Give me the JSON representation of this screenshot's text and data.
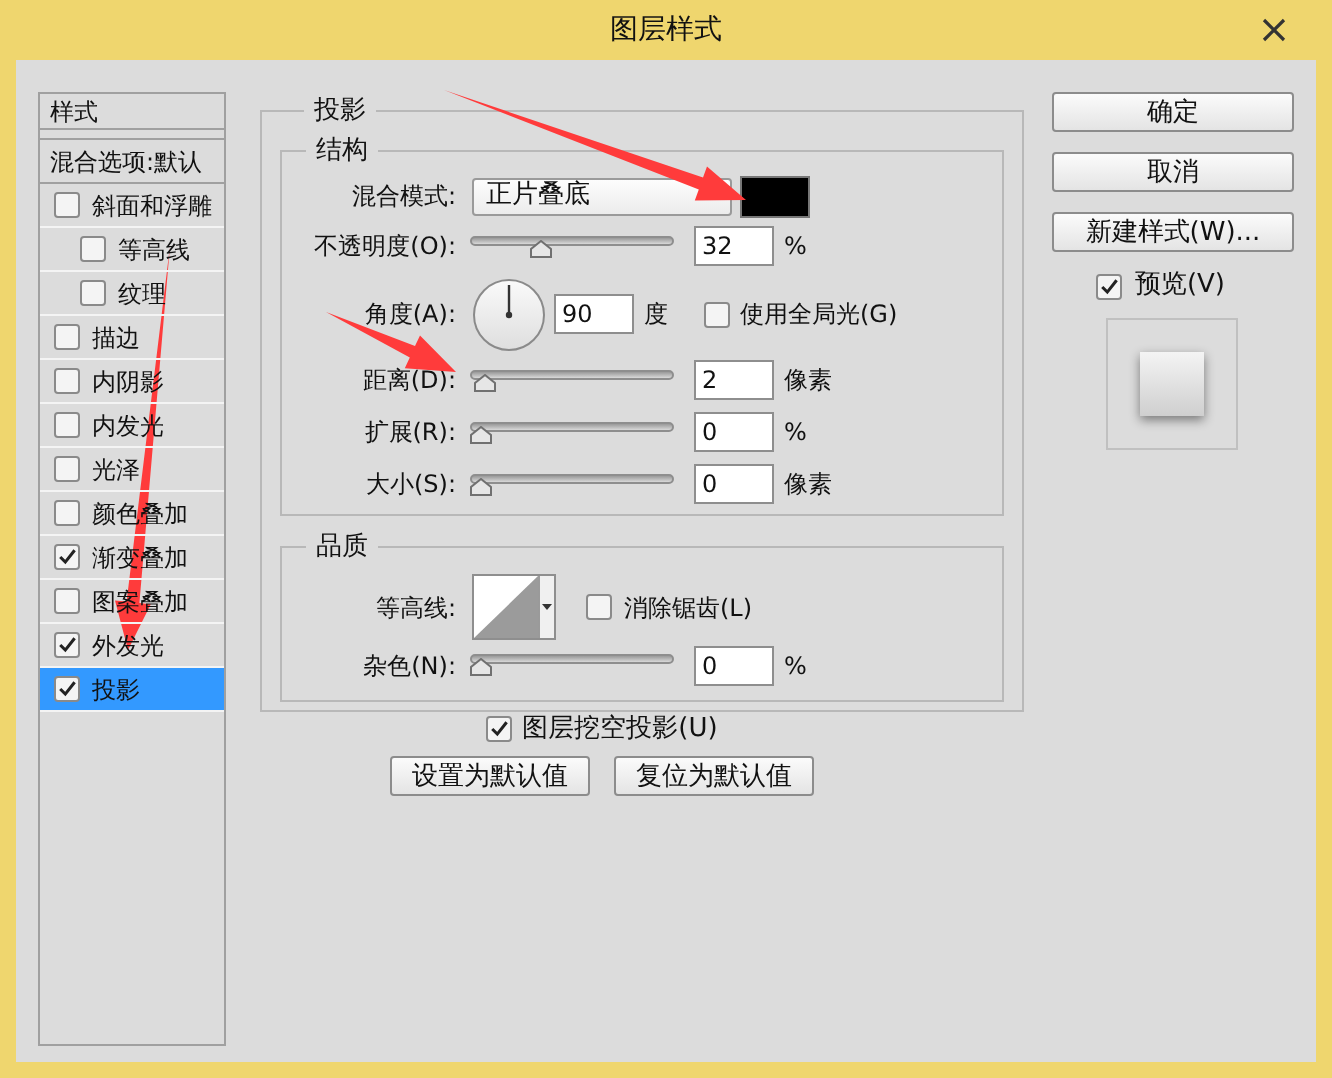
{
  "window": {
    "title": "图层样式"
  },
  "styles_list": {
    "header": "样式",
    "blending_options": "混合选项:默认",
    "items": [
      {
        "label": "斜面和浮雕",
        "checked": false,
        "selected": false,
        "children": [
          {
            "label": "等高线",
            "checked": false,
            "selected": false
          },
          {
            "label": "纹理",
            "checked": false,
            "selected": false
          }
        ]
      },
      {
        "label": "描边",
        "checked": false,
        "selected": false
      },
      {
        "label": "内阴影",
        "checked": false,
        "selected": false
      },
      {
        "label": "内发光",
        "checked": false,
        "selected": false
      },
      {
        "label": "光泽",
        "checked": false,
        "selected": false
      },
      {
        "label": "颜色叠加",
        "checked": false,
        "selected": false
      },
      {
        "label": "渐变叠加",
        "checked": true,
        "selected": false
      },
      {
        "label": "图案叠加",
        "checked": false,
        "selected": false
      },
      {
        "label": "外发光",
        "checked": true,
        "selected": false
      },
      {
        "label": "投影",
        "checked": true,
        "selected": true
      }
    ]
  },
  "drop_shadow": {
    "title": "投影",
    "structure": {
      "title": "结构",
      "blend_mode": {
        "label": "混合模式:",
        "value": "正片叠底",
        "color": "#000000"
      },
      "opacity": {
        "label": "不透明度(O):",
        "level": 0.32,
        "value": "32",
        "unit": "%"
      },
      "angle": {
        "label": "角度(A):",
        "value": "90",
        "unit": "度",
        "global_light": {
          "label": "使用全局光(G)",
          "checked": false
        }
      },
      "distance": {
        "label": "距离(D):",
        "level": 0.02,
        "value": "2",
        "unit": "像素"
      },
      "spread": {
        "label": "扩展(R):",
        "level": 0,
        "value": "0",
        "unit": "%"
      },
      "size": {
        "label": "大小(S):",
        "level": 0,
        "value": "0",
        "unit": "像素"
      }
    },
    "quality": {
      "title": "品质",
      "contour": {
        "label": "等高线:"
      },
      "anti_alias": {
        "label": "消除锯齿(L)",
        "checked": false
      },
      "noise": {
        "label": "杂色(N):",
        "level": 0,
        "value": "0",
        "unit": "%"
      }
    },
    "knockout": {
      "label": "图层挖空投影(U)",
      "checked": true
    },
    "buttons": [
      "设置为默认值",
      "复位为默认值"
    ]
  },
  "actions": {
    "buttons": [
      "确定",
      "取消",
      "新建样式(W)..."
    ],
    "preview": {
      "label": "预览(V)",
      "checked": true
    }
  },
  "annotations": [
    {
      "kind": "arrow"
    },
    {
      "kind": "arrow"
    },
    {
      "kind": "arrow"
    }
  ]
}
